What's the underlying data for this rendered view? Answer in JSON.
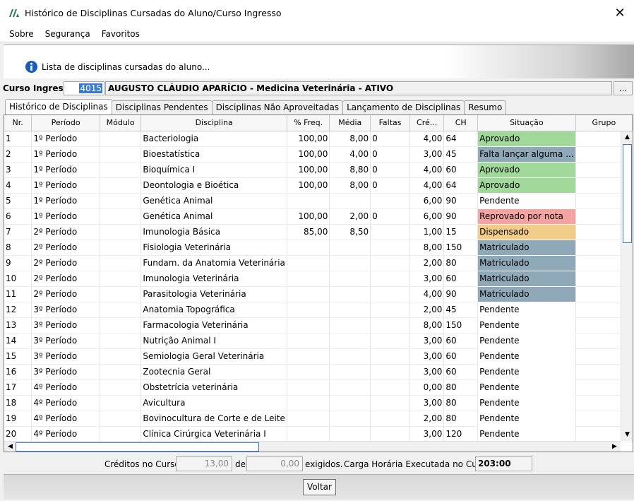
{
  "window": {
    "title": "Histórico de Disciplinas Cursadas do Aluno/Curso Ingresso",
    "close_icon": "close-icon"
  },
  "menu": {
    "items": [
      "Sobre",
      "Segurança",
      "Favoritos"
    ]
  },
  "info": {
    "text": "Lista de disciplinas cursadas do aluno..."
  },
  "curso": {
    "label": "Curso Ingresso:",
    "code": "4015",
    "name": "AUGUSTO CLÁUDIO APARÍCIO - Medicina Veterinária - ATIVO",
    "lookup": "..."
  },
  "tabs": [
    "Histórico de Disciplinas",
    "Disciplinas Pendentes",
    "Disciplinas Não Aproveitadas",
    "Lançamento de Disciplinas",
    "Resumo"
  ],
  "grid": {
    "columns": [
      "Nr.",
      "Período",
      "Módulo",
      "Disciplina",
      "% Freq.",
      "Média",
      "Faltas",
      "Cré...",
      "CH",
      "Situação",
      "Grupo"
    ],
    "rows": [
      [
        "1",
        "1º Período",
        "",
        "Bacteriologia",
        "100,00",
        "8,00",
        "0",
        "4,00",
        "64",
        "Aprovado",
        ""
      ],
      [
        "2",
        "1º Período",
        "",
        "Bioestatística",
        "100,00",
        "4,00",
        "0",
        "3,00",
        "45",
        "Falta lançar alguma ...",
        ""
      ],
      [
        "3",
        "1º Período",
        "",
        "Bioquímica I",
        "100,00",
        "8,80",
        "0",
        "4,00",
        "60",
        "Aprovado",
        ""
      ],
      [
        "4",
        "1º Período",
        "",
        "Deontologia e Bioética",
        "100,00",
        "8,00",
        "0",
        "4,00",
        "64",
        "Aprovado",
        ""
      ],
      [
        "5",
        "1º Período",
        "",
        "Genética Animal",
        "",
        "",
        "",
        "6,00",
        "90",
        "Pendente",
        ""
      ],
      [
        "6",
        "1º Período",
        "",
        "Genética Animal",
        "100,00",
        "2,00",
        "0",
        "6,00",
        "90",
        "Reprovado por nota",
        ""
      ],
      [
        "7",
        "2º Período",
        "",
        "Imunologia Básica",
        "85,00",
        "8,50",
        "",
        "1,00",
        "15",
        "Dispensado",
        ""
      ],
      [
        "8",
        "2º Período",
        "",
        "Fisiologia Veterinária",
        "",
        "",
        "",
        "8,00",
        "150",
        "Matriculado",
        ""
      ],
      [
        "9",
        "2º Período",
        "",
        "Fundam. da Anatomia Veterinária",
        "",
        "",
        "",
        "2,00",
        "80",
        "Matriculado",
        ""
      ],
      [
        "10",
        "2º Período",
        "",
        "Imunologia Veterinária",
        "",
        "",
        "",
        "3,00",
        "60",
        "Matriculado",
        ""
      ],
      [
        "11",
        "2º Período",
        "",
        "Parasitologia Veterinária",
        "",
        "",
        "",
        "4,00",
        "90",
        "Matriculado",
        ""
      ],
      [
        "12",
        "3º Período",
        "",
        "Anatomia Topográfica",
        "",
        "",
        "",
        "2,00",
        "45",
        "Pendente",
        ""
      ],
      [
        "13",
        "3º Período",
        "",
        "Farmacologia Veterinária",
        "",
        "",
        "",
        "8,00",
        "150",
        "Pendente",
        ""
      ],
      [
        "14",
        "3º Período",
        "",
        "Nutrição Animal I",
        "",
        "",
        "",
        "3,00",
        "60",
        "Pendente",
        ""
      ],
      [
        "15",
        "3º Período",
        "",
        "Semiologia Geral Veterinária",
        "",
        "",
        "",
        "3,00",
        "60",
        "Pendente",
        ""
      ],
      [
        "16",
        "3º Período",
        "",
        "Zootecnia Geral",
        "",
        "",
        "",
        "3,00",
        "60",
        "Pendente",
        ""
      ],
      [
        "17",
        "4º Período",
        "",
        "Obstetrícia veterinária",
        "",
        "",
        "",
        "0,00",
        "80",
        "Pendente",
        ""
      ],
      [
        "18",
        "4º Período",
        "",
        "Avicultura",
        "",
        "",
        "",
        "3,00",
        "80",
        "Pendente",
        ""
      ],
      [
        "19",
        "4º Período",
        "",
        "Bovinocultura de Corte e de Leite",
        "",
        "",
        "",
        "2,00",
        "80",
        "Pendente",
        ""
      ],
      [
        "20",
        "4º Período",
        "",
        "Clínica Cirúrgica Veterinária I",
        "",
        "",
        "",
        "3,00",
        "120",
        "Pendente",
        ""
      ]
    ],
    "status_colors": {
      "Aprovado": "#a1d99b",
      "Falta lançar alguma ...": "#8fa9b8",
      "Reprovado por nota": "#f4a3a3",
      "Dispensado": "#f2cd8a",
      "Matriculado": "#8fa9b8",
      "Pendente": "#ffffff"
    }
  },
  "footer": {
    "creditos_label": "Créditos no Curso:",
    "creditos_value": "13,00",
    "de_label": "de",
    "exigidos_value": "0,00",
    "exigidos_label": "exigidos.",
    "carga_label": "Carga Horária Executada no Curso:",
    "carga_value": "203:00"
  },
  "buttons": {
    "voltar": "Voltar"
  }
}
